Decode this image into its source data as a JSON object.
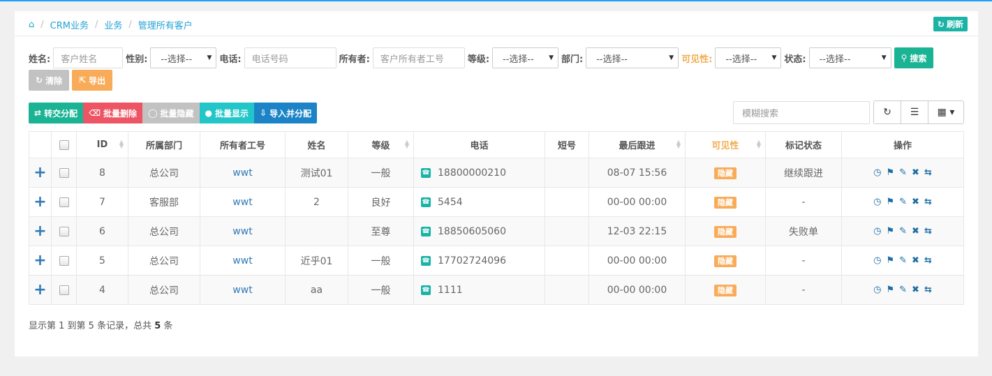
{
  "breadcrumb": {
    "items": [
      "CRM业务",
      "业务",
      "管理所有客户"
    ]
  },
  "refresh_label": "刷新",
  "filters": {
    "name_label": "姓名:",
    "name_placeholder": "客户姓名",
    "gender_label": "性别:",
    "gender_value": "--选择--",
    "phone_label": "电话:",
    "phone_placeholder": "电话号码",
    "owner_label": "所有者:",
    "owner_placeholder": "客户所有者工号",
    "level_label": "等级:",
    "level_value": "--选择--",
    "dept_label": "部门:",
    "dept_value": "--选择--",
    "visible_label": "可见性:",
    "visible_value": "--选择--",
    "status_label": "状态:",
    "status_value": "--选择--",
    "search_btn": "搜索",
    "clear_btn": "清除",
    "export_btn": "导出"
  },
  "toolbar": {
    "transfer": "转交分配",
    "batch_delete": "批量删除",
    "batch_hide": "批量隐藏",
    "batch_show": "批量显示",
    "import": "导入并分配"
  },
  "fuzzy_search_placeholder": "模糊搜索",
  "columns": [
    "ID",
    "所属部门",
    "所有者工号",
    "姓名",
    "等级",
    "电话",
    "短号",
    "最后跟进",
    "可见性",
    "标记状态",
    "操作"
  ],
  "rows": [
    {
      "id": "8",
      "dept": "总公司",
      "owner": "wwt",
      "name": "测试01",
      "level": "一般",
      "phone": "18800000210",
      "short": "",
      "last": "08-07 15:56",
      "visible": "隐藏",
      "status": "继续跟进"
    },
    {
      "id": "7",
      "dept": "客服部",
      "owner": "wwt",
      "name": "2",
      "level": "良好",
      "phone": "5454",
      "short": "",
      "last": "00-00 00:00",
      "visible": "隐藏",
      "status": "-"
    },
    {
      "id": "6",
      "dept": "总公司",
      "owner": "wwt",
      "name": "",
      "level": "至尊",
      "phone": "18850605060",
      "short": "",
      "last": "12-03 22:15",
      "visible": "隐藏",
      "status": "失败单"
    },
    {
      "id": "5",
      "dept": "总公司",
      "owner": "wwt",
      "name": "近乎01",
      "level": "一般",
      "phone": "17702724096",
      "short": "",
      "last": "00-00 00:00",
      "visible": "隐藏",
      "status": "-"
    },
    {
      "id": "4",
      "dept": "总公司",
      "owner": "wwt",
      "name": "aa",
      "level": "一般",
      "phone": "1111",
      "short": "",
      "last": "00-00 00:00",
      "visible": "隐藏",
      "status": "-"
    }
  ],
  "footer": {
    "prefix": "显示第 1 到第 5 条记录，总共 ",
    "total": "5",
    "suffix": " 条"
  }
}
